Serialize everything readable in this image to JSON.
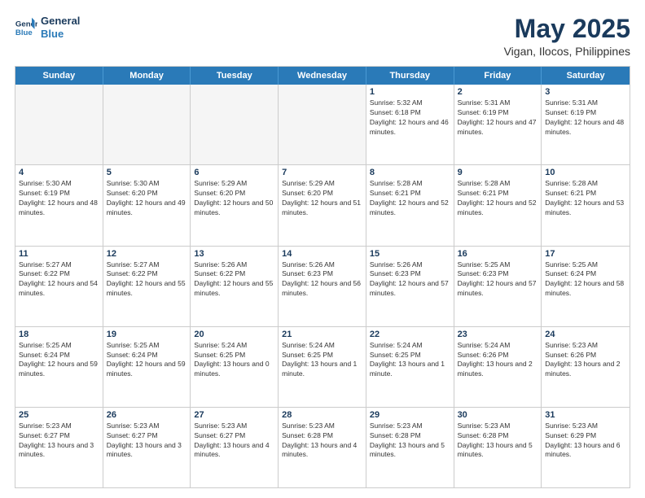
{
  "header": {
    "logo_line1": "General",
    "logo_line2": "Blue",
    "title": "May 2025",
    "subtitle": "Vigan, Ilocos, Philippines"
  },
  "calendar": {
    "days_of_week": [
      "Sunday",
      "Monday",
      "Tuesday",
      "Wednesday",
      "Thursday",
      "Friday",
      "Saturday"
    ],
    "weeks": [
      {
        "cells": [
          {
            "day": "",
            "empty": true
          },
          {
            "day": "",
            "empty": true
          },
          {
            "day": "",
            "empty": true
          },
          {
            "day": "",
            "empty": true
          },
          {
            "day": "1",
            "sunrise": "5:32 AM",
            "sunset": "6:18 PM",
            "daylight": "12 hours and 46 minutes."
          },
          {
            "day": "2",
            "sunrise": "5:31 AM",
            "sunset": "6:19 PM",
            "daylight": "12 hours and 47 minutes."
          },
          {
            "day": "3",
            "sunrise": "5:31 AM",
            "sunset": "6:19 PM",
            "daylight": "12 hours and 48 minutes."
          }
        ]
      },
      {
        "cells": [
          {
            "day": "4",
            "sunrise": "5:30 AM",
            "sunset": "6:19 PM",
            "daylight": "12 hours and 48 minutes."
          },
          {
            "day": "5",
            "sunrise": "5:30 AM",
            "sunset": "6:20 PM",
            "daylight": "12 hours and 49 minutes."
          },
          {
            "day": "6",
            "sunrise": "5:29 AM",
            "sunset": "6:20 PM",
            "daylight": "12 hours and 50 minutes."
          },
          {
            "day": "7",
            "sunrise": "5:29 AM",
            "sunset": "6:20 PM",
            "daylight": "12 hours and 51 minutes."
          },
          {
            "day": "8",
            "sunrise": "5:28 AM",
            "sunset": "6:21 PM",
            "daylight": "12 hours and 52 minutes."
          },
          {
            "day": "9",
            "sunrise": "5:28 AM",
            "sunset": "6:21 PM",
            "daylight": "12 hours and 52 minutes."
          },
          {
            "day": "10",
            "sunrise": "5:28 AM",
            "sunset": "6:21 PM",
            "daylight": "12 hours and 53 minutes."
          }
        ]
      },
      {
        "cells": [
          {
            "day": "11",
            "sunrise": "5:27 AM",
            "sunset": "6:22 PM",
            "daylight": "12 hours and 54 minutes."
          },
          {
            "day": "12",
            "sunrise": "5:27 AM",
            "sunset": "6:22 PM",
            "daylight": "12 hours and 55 minutes."
          },
          {
            "day": "13",
            "sunrise": "5:26 AM",
            "sunset": "6:22 PM",
            "daylight": "12 hours and 55 minutes."
          },
          {
            "day": "14",
            "sunrise": "5:26 AM",
            "sunset": "6:23 PM",
            "daylight": "12 hours and 56 minutes."
          },
          {
            "day": "15",
            "sunrise": "5:26 AM",
            "sunset": "6:23 PM",
            "daylight": "12 hours and 57 minutes."
          },
          {
            "day": "16",
            "sunrise": "5:25 AM",
            "sunset": "6:23 PM",
            "daylight": "12 hours and 57 minutes."
          },
          {
            "day": "17",
            "sunrise": "5:25 AM",
            "sunset": "6:24 PM",
            "daylight": "12 hours and 58 minutes."
          }
        ]
      },
      {
        "cells": [
          {
            "day": "18",
            "sunrise": "5:25 AM",
            "sunset": "6:24 PM",
            "daylight": "12 hours and 59 minutes."
          },
          {
            "day": "19",
            "sunrise": "5:25 AM",
            "sunset": "6:24 PM",
            "daylight": "12 hours and 59 minutes."
          },
          {
            "day": "20",
            "sunrise": "5:24 AM",
            "sunset": "6:25 PM",
            "daylight": "13 hours and 0 minutes."
          },
          {
            "day": "21",
            "sunrise": "5:24 AM",
            "sunset": "6:25 PM",
            "daylight": "13 hours and 1 minute."
          },
          {
            "day": "22",
            "sunrise": "5:24 AM",
            "sunset": "6:25 PM",
            "daylight": "13 hours and 1 minute."
          },
          {
            "day": "23",
            "sunrise": "5:24 AM",
            "sunset": "6:26 PM",
            "daylight": "13 hours and 2 minutes."
          },
          {
            "day": "24",
            "sunrise": "5:23 AM",
            "sunset": "6:26 PM",
            "daylight": "13 hours and 2 minutes."
          }
        ]
      },
      {
        "cells": [
          {
            "day": "25",
            "sunrise": "5:23 AM",
            "sunset": "6:27 PM",
            "daylight": "13 hours and 3 minutes."
          },
          {
            "day": "26",
            "sunrise": "5:23 AM",
            "sunset": "6:27 PM",
            "daylight": "13 hours and 3 minutes."
          },
          {
            "day": "27",
            "sunrise": "5:23 AM",
            "sunset": "6:27 PM",
            "daylight": "13 hours and 4 minutes."
          },
          {
            "day": "28",
            "sunrise": "5:23 AM",
            "sunset": "6:28 PM",
            "daylight": "13 hours and 4 minutes."
          },
          {
            "day": "29",
            "sunrise": "5:23 AM",
            "sunset": "6:28 PM",
            "daylight": "13 hours and 5 minutes."
          },
          {
            "day": "30",
            "sunrise": "5:23 AM",
            "sunset": "6:28 PM",
            "daylight": "13 hours and 5 minutes."
          },
          {
            "day": "31",
            "sunrise": "5:23 AM",
            "sunset": "6:29 PM",
            "daylight": "13 hours and 6 minutes."
          }
        ]
      }
    ]
  }
}
